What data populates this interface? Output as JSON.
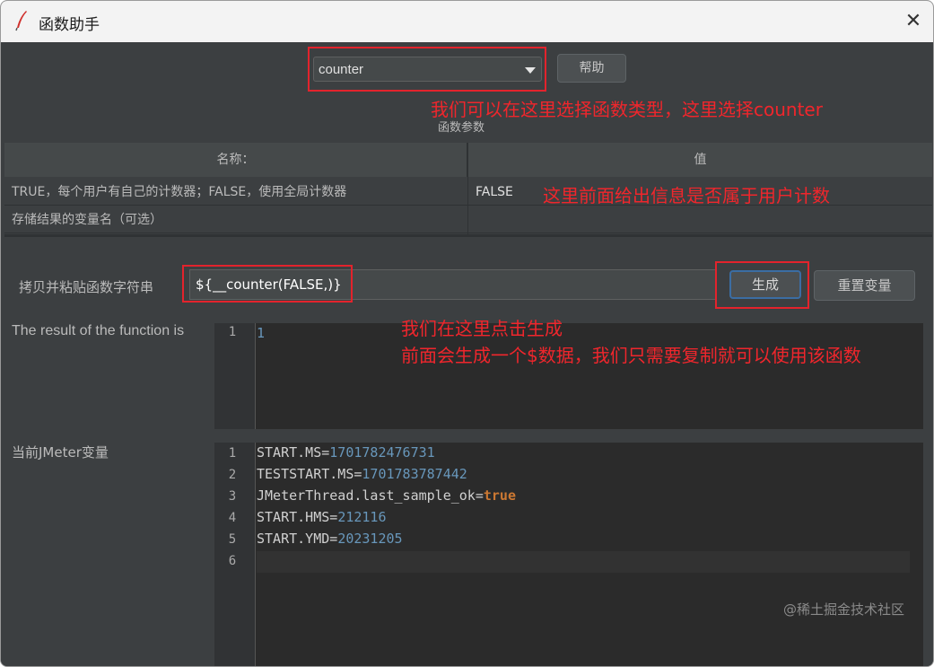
{
  "window": {
    "title": "函数助手",
    "close_label": "✕"
  },
  "function_select": {
    "selected": "counter"
  },
  "help_button": "帮助",
  "params": {
    "section_title": "函数参数",
    "columns": [
      "名称：",
      "值"
    ],
    "rows": [
      {
        "name": "TRUE，每个用户有自己的计数器；FALSE，使用全局计数器",
        "value": "FALSE"
      },
      {
        "name": "存储结果的变量名（可选）",
        "value": ""
      }
    ]
  },
  "function_string": {
    "label": "拷贝并粘贴函数字符串",
    "value": "${__counter(FALSE,)}"
  },
  "buttons": {
    "generate": "生成",
    "reset": "重置变量"
  },
  "result": {
    "label": "The result of the function is",
    "lines": [
      {
        "n": "1",
        "text": "1"
      }
    ]
  },
  "jmeter_vars": {
    "label": "当前JMeter变量",
    "lines": [
      {
        "n": "1",
        "key": "START.MS=",
        "value": "1701782476731"
      },
      {
        "n": "2",
        "key": "TESTSTART.MS=",
        "value": "1701783787442"
      },
      {
        "n": "3",
        "key": "JMeterThread.last_sample_ok=",
        "value": "true"
      },
      {
        "n": "4",
        "key": "START.HMS=",
        "value": "212116"
      },
      {
        "n": "5",
        "key": "START.YMD=",
        "value": "20231205"
      },
      {
        "n": "6",
        "key": "",
        "value": ""
      }
    ]
  },
  "annotations": {
    "select_note": "我们可以在这里选择函数类型，这里选择counter",
    "value_note": "这里前面给出信息是否属于用户计数",
    "generate_note_1": "我们在这里点击生成",
    "generate_note_2": "前面会生成一个$数据，我们只需要复制就可以使用该函数"
  },
  "watermark": "@稀土掘金技术社区",
  "colors": {
    "background": "#3c3f41",
    "annotation": "#f0262c",
    "number": "#6897bb",
    "keyword": "#cc7832"
  }
}
